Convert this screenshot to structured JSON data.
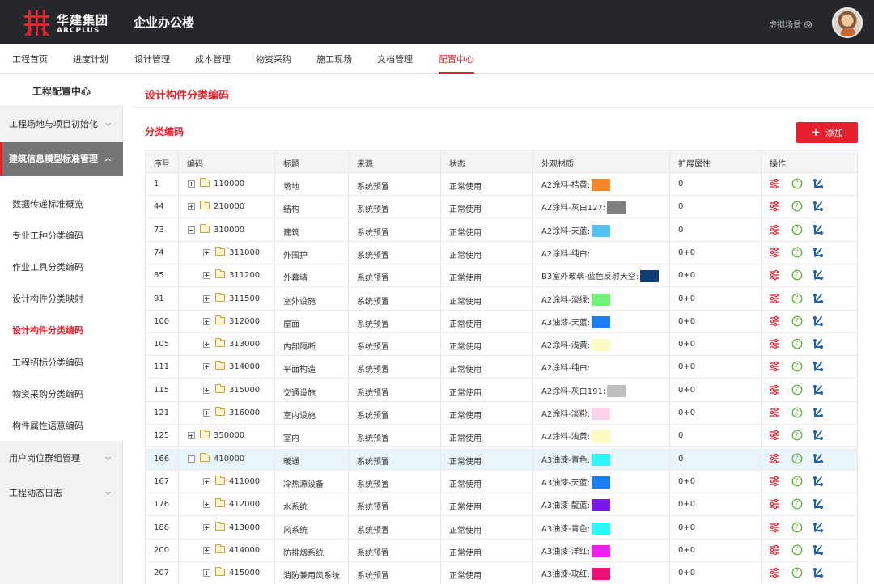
{
  "header": {
    "logo_cn": "华建集团",
    "logo_en": "ARCPLUS",
    "app_title": "企业办公楼",
    "scene_label": "虚拟场景"
  },
  "nav": [
    "工程首页",
    "进度计划",
    "设计管理",
    "成本管理",
    "物资采购",
    "施工现场",
    "文档管理",
    "配置中心"
  ],
  "sidebar": {
    "title": "工程配置中心",
    "groups": [
      "工程场地与项目初始化",
      "建筑信息模型标准管理",
      "用户岗位群组管理",
      "工程动态日志"
    ],
    "items": [
      "数据传递标准概览",
      "专业工种分类编码",
      "作业工具分类编码",
      "设计构件分类映射",
      "设计构件分类编码",
      "工程招标分类编码",
      "物资采购分类编码",
      "构件属性语意编码"
    ]
  },
  "main": {
    "page_title": "设计构件分类编码",
    "section_title": "分类编码",
    "add_label": "添加"
  },
  "table": {
    "headers": [
      "序号",
      "编码",
      "标题",
      "来源",
      "状态",
      "外观材质",
      "扩展属性",
      "操作"
    ],
    "rows": [
      {
        "no": "1",
        "code": "110000",
        "title": "场地",
        "source": "系统预置",
        "status": "正常使用",
        "material": "A2涂料-桔黄:",
        "color": "#f7862a",
        "ext": "0",
        "level": 0,
        "tree": "plus"
      },
      {
        "no": "44",
        "code": "210000",
        "title": "结构",
        "source": "系统预置",
        "status": "正常使用",
        "material": "A2涂料-灰白127:",
        "color": "#7f7f7f",
        "ext": "0",
        "level": 0,
        "tree": "plus"
      },
      {
        "no": "73",
        "code": "310000",
        "title": "建筑",
        "source": "系统预置",
        "status": "正常使用",
        "material": "A2涂料-天蓝:",
        "color": "#55c2f2",
        "ext": "0",
        "level": 0,
        "tree": "minus"
      },
      {
        "no": "74",
        "code": "311000",
        "title": "外围护",
        "source": "系统预置",
        "status": "正常使用",
        "material": "A2涂料-纯白:",
        "color": "",
        "ext": "0+0",
        "level": 1,
        "tree": "plus"
      },
      {
        "no": "85",
        "code": "311200",
        "title": "外幕墙",
        "source": "系统预置",
        "status": "正常使用",
        "material": "B3室外玻璃-蓝色反射天空:",
        "color": "#0f3d74",
        "ext": "0+0",
        "level": 1,
        "tree": "plus"
      },
      {
        "no": "91",
        "code": "311500",
        "title": "室外设施",
        "source": "系统预置",
        "status": "正常使用",
        "material": "A2涂料-淡绿:",
        "color": "#73f27a",
        "ext": "0+0",
        "level": 1,
        "tree": "plus"
      },
      {
        "no": "100",
        "code": "312000",
        "title": "屋面",
        "source": "系统预置",
        "status": "正常使用",
        "material": "A3油漆-天蓝:",
        "color": "#1a80ef",
        "ext": "0+0",
        "level": 1,
        "tree": "plus"
      },
      {
        "no": "105",
        "code": "313000",
        "title": "内部隔断",
        "source": "系统预置",
        "status": "正常使用",
        "material": "A2涂料-浅黄:",
        "color": "#fdfbc2",
        "ext": "0+0",
        "level": 1,
        "tree": "plus"
      },
      {
        "no": "111",
        "code": "314000",
        "title": "平面构造",
        "source": "系统预置",
        "status": "正常使用",
        "material": "A2涂料-纯白:",
        "color": "",
        "ext": "0+0",
        "level": 1,
        "tree": "plus"
      },
      {
        "no": "115",
        "code": "315000",
        "title": "交通设施",
        "source": "系统预置",
        "status": "正常使用",
        "material": "A2涂料-灰白191:",
        "color": "#bfbfbf",
        "ext": "0+0",
        "level": 1,
        "tree": "plus"
      },
      {
        "no": "121",
        "code": "316000",
        "title": "室内设施",
        "source": "系统预置",
        "status": "正常使用",
        "material": "A2涂料-淡粉:",
        "color": "#fcd2ea",
        "ext": "0+0",
        "level": 1,
        "tree": "plus"
      },
      {
        "no": "125",
        "code": "350000",
        "title": "室内",
        "source": "系统预置",
        "status": "正常使用",
        "material": "A2涂料-浅黄:",
        "color": "#fdfbc2",
        "ext": "0",
        "level": 0,
        "tree": "plus"
      },
      {
        "no": "166",
        "code": "410000",
        "title": "暖通",
        "source": "系统预置",
        "status": "正常使用",
        "material": "A3油漆-青色:",
        "color": "#2ff6f8",
        "ext": "0",
        "level": 0,
        "tree": "minus",
        "highlight": true
      },
      {
        "no": "167",
        "code": "411000",
        "title": "冷热源设备",
        "source": "系统预置",
        "status": "正常使用",
        "material": "A3油漆-天蓝:",
        "color": "#1a80ef",
        "ext": "0+0",
        "level": 1,
        "tree": "plus"
      },
      {
        "no": "176",
        "code": "412000",
        "title": "水系统",
        "source": "系统预置",
        "status": "正常使用",
        "material": "A3油漆-靛蓝:",
        "color": "#7b16ec",
        "ext": "0+0",
        "level": 1,
        "tree": "plus"
      },
      {
        "no": "188",
        "code": "413000",
        "title": "风系统",
        "source": "系统预置",
        "status": "正常使用",
        "material": "A3油漆-青色:",
        "color": "#2ff6f8",
        "ext": "0+0",
        "level": 1,
        "tree": "plus"
      },
      {
        "no": "200",
        "code": "414000",
        "title": "防排烟系统",
        "source": "系统预置",
        "status": "正常使用",
        "material": "A3油漆-洋红:",
        "color": "#f01cf0",
        "ext": "0+0",
        "level": 1,
        "tree": "plus"
      },
      {
        "no": "207",
        "code": "415000",
        "title": "消防兼用风系统",
        "source": "系统预置",
        "status": "正常使用",
        "material": "A3油漆-玫红:",
        "color": "#ee1178",
        "ext": "0+0",
        "level": 1,
        "tree": "plus"
      }
    ]
  },
  "colors": {
    "accent": "#e7202d",
    "topbar": "#25272b",
    "sidebar_open": "#757575",
    "row_highlight": "#eaf4fb"
  },
  "icons": {
    "settings": "sliders-icon",
    "info": "info-icon",
    "link": "connect-icon",
    "add": "plus-icon"
  }
}
